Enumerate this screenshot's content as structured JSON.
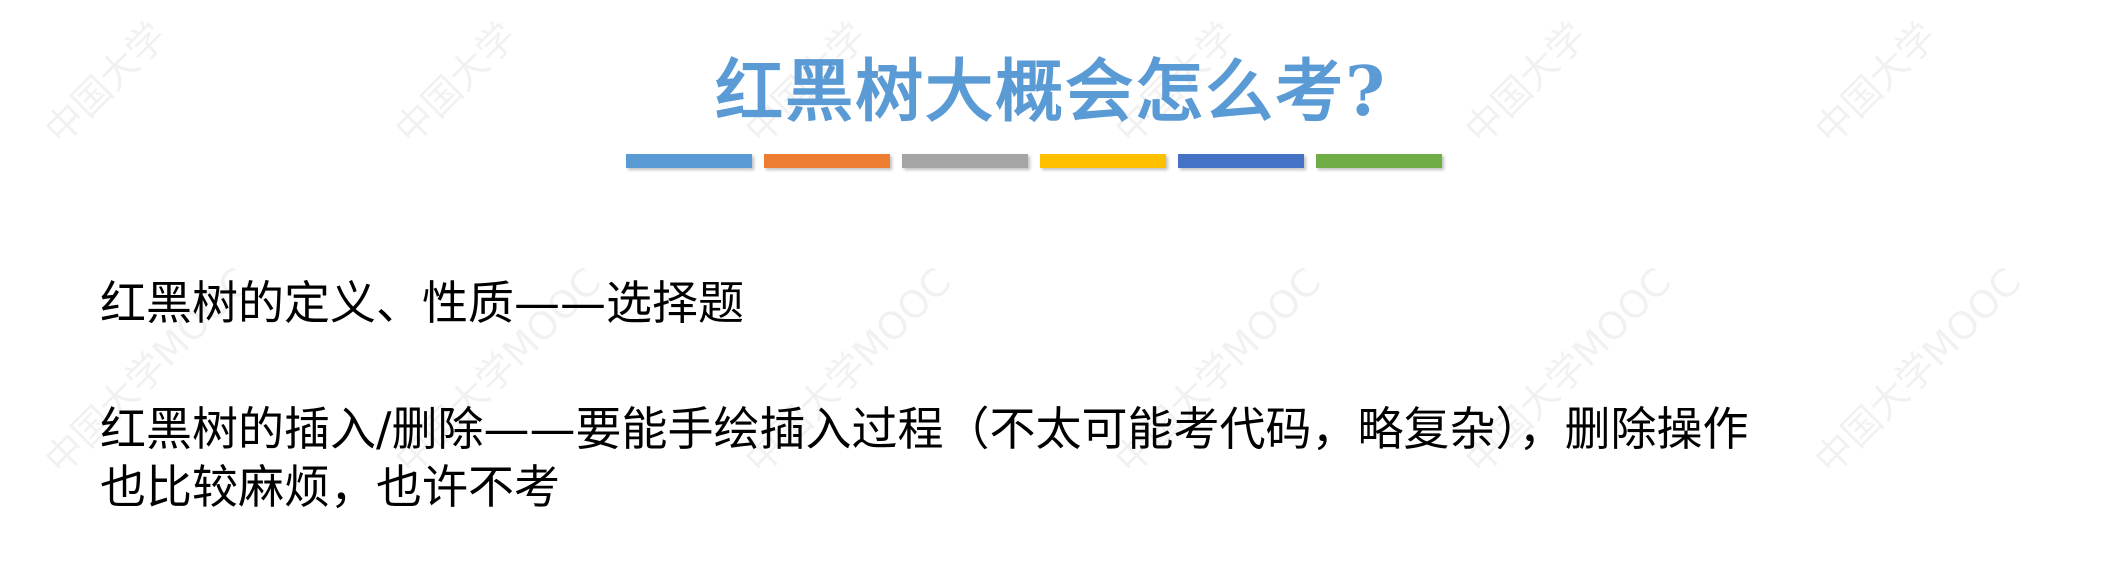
{
  "title": "红黑树大概会怎么考?",
  "colors": {
    "title": "#5b9bd5",
    "text": "#000000",
    "bars": [
      "#5b9bd5",
      "#ed7d31",
      "#a5a5a5",
      "#ffc000",
      "#4472c4",
      "#70ad47"
    ]
  },
  "body": {
    "line1": "红黑树的定义、性质——选择题",
    "line2": "红黑树的插入/删除——要能手绘插入过程（不太可能考代码，略复杂），删除操作",
    "line3": "也比较麻烦，也许不考"
  },
  "watermark": {
    "text_a": "中国大学",
    "text_b": "中国大学MOOC"
  }
}
